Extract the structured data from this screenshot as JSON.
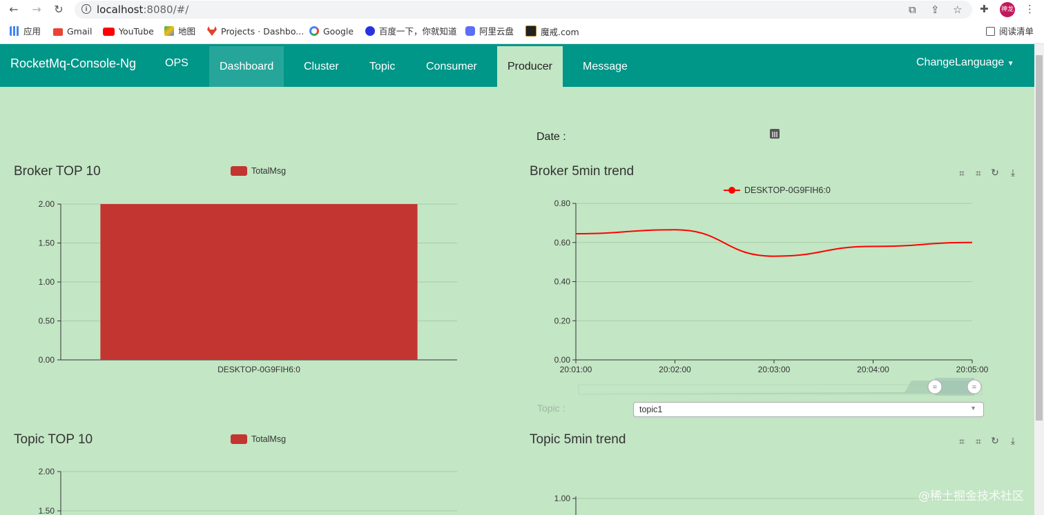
{
  "browser": {
    "url_host": "localhost",
    "url_rest": ":8080/#/",
    "avatar_text": "神龙",
    "bookmarks": [
      {
        "label": "应用",
        "icon": "apps-grid-icon",
        "color": "#4285f4"
      },
      {
        "label": "Gmail",
        "icon": "gmail-icon",
        "color": "#ea4335"
      },
      {
        "label": "YouTube",
        "icon": "youtube-icon",
        "color": "#ff0000"
      },
      {
        "label": "地图",
        "icon": "maps-icon",
        "color": "#34a853"
      },
      {
        "label": "Projects · Dashbo...",
        "icon": "gitlab-icon",
        "color": "#e24329"
      },
      {
        "label": "Google",
        "icon": "google-icon",
        "color": "#4285f4"
      },
      {
        "label": "百度一下，你就知道",
        "icon": "baidu-icon",
        "color": "#2932e1"
      },
      {
        "label": "阿里云盘",
        "icon": "aliyun-drive-icon",
        "color": "#5b6ef5"
      },
      {
        "label": "魔戒.com",
        "icon": "mojie-icon",
        "color": "#222222"
      }
    ],
    "reading_list": "阅读清单"
  },
  "navbar": {
    "brand": "RocketMq-Console-Ng",
    "items": [
      "OPS",
      "Dashboard",
      "Cluster",
      "Topic",
      "Consumer",
      "Producer",
      "Message"
    ],
    "active": "Producer",
    "hover": "Dashboard",
    "language": "ChangeLanguage",
    "color": "#009688"
  },
  "date": {
    "label": "Date :"
  },
  "broker_top": {
    "title": "Broker TOP 10",
    "legend": "TotalMsg",
    "chart_data": {
      "type": "bar",
      "categories": [
        "DESKTOP-0G9FIH6:0"
      ],
      "series": [
        {
          "name": "TotalMsg",
          "values": [
            2
          ]
        }
      ],
      "yticks": [
        "0.00",
        "0.50",
        "1.00",
        "1.50",
        "2.00"
      ],
      "ylim": [
        0,
        2
      ],
      "color": "#c23531"
    }
  },
  "broker_trend": {
    "title": "Broker 5min trend",
    "chart_data": {
      "type": "line",
      "x": [
        "20:01:00",
        "20:02:00",
        "20:03:00",
        "20:04:00",
        "20:05:00"
      ],
      "series": [
        {
          "name": "DESKTOP-0G9FIH6:0",
          "values": [
            0.645,
            0.665,
            0.53,
            0.58,
            0.6
          ]
        }
      ],
      "yticks": [
        "0.00",
        "0.20",
        "0.40",
        "0.60",
        "0.80"
      ],
      "ylim": [
        0,
        0.8
      ],
      "color": "#ff0000"
    }
  },
  "topic_select": {
    "label": "Topic :",
    "value": "topic1"
  },
  "topic_top": {
    "title": "Topic TOP 10",
    "legend": "TotalMsg",
    "chart_data": {
      "type": "bar",
      "yticks": [
        "2.00",
        "1.50"
      ],
      "ylim": [
        0,
        2
      ]
    }
  },
  "topic_trend": {
    "title": "Topic 5min trend",
    "chart_data": {
      "type": "line",
      "yticks": [
        "1.00"
      ]
    }
  },
  "watermark": "@稀土掘金技术社区"
}
